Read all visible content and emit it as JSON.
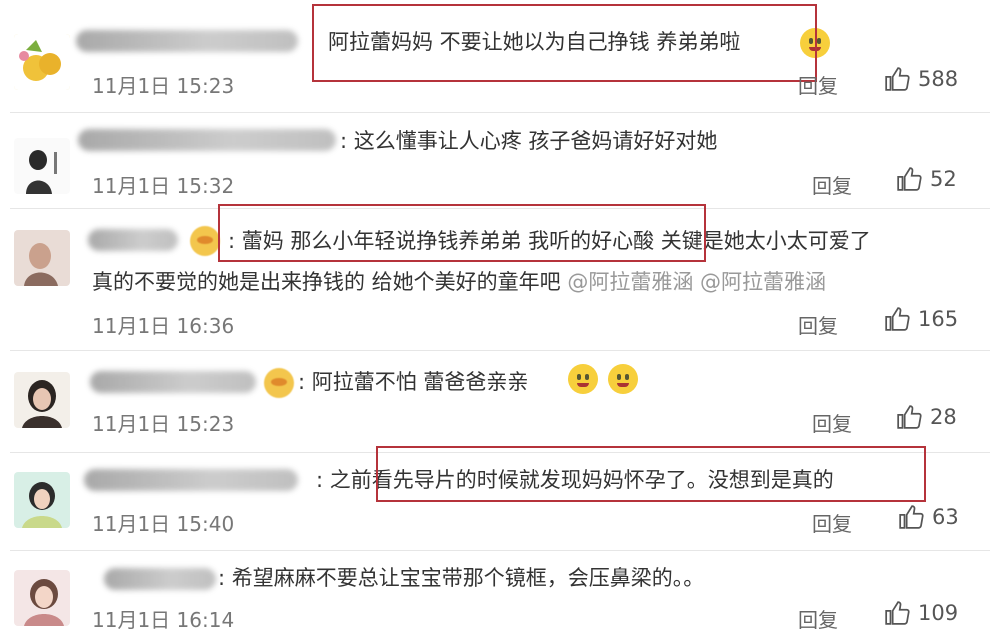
{
  "comments": [
    {
      "text": "阿拉蕾妈妈 不要让她以为自己挣钱 养弟弟啦",
      "time": "11月1日 15:23",
      "reply": "回复",
      "likes": "588"
    },
    {
      "text": ": 这么懂事让人心疼 孩子爸妈请好好对她",
      "time": "11月1日 15:32",
      "reply": "回复",
      "likes": "52"
    },
    {
      "text": ": 蕾妈 那么小年轻说挣钱养弟弟 我听的好心酸 关键是她太小太可爱了",
      "text2": "真的不要觉的她是出来挣钱的 给她个美好的童年吧",
      "mentions": "@阿拉蕾雅涵 @阿拉蕾雅涵",
      "time": "11月1日 16:36",
      "reply": "回复",
      "likes": "165"
    },
    {
      "text": ": 阿拉蕾不怕 蕾爸爸亲亲",
      "time": "11月1日 15:23",
      "reply": "回复",
      "likes": "28"
    },
    {
      "text": ": 之前看先导片的时候就发现妈妈怀孕了。没想到是真的",
      "time": "11月1日 15:40",
      "reply": "回复",
      "likes": "63"
    },
    {
      "text": ": 希望麻麻不要总让宝宝带那个镜框，会压鼻梁的。。",
      "time": "11月1日 16:14",
      "reply": "回复",
      "likes": "109"
    }
  ],
  "icons": {
    "like": "thumbs-up-icon"
  },
  "colors": {
    "highlight_box": "#b5333b",
    "mention": "#999999"
  }
}
